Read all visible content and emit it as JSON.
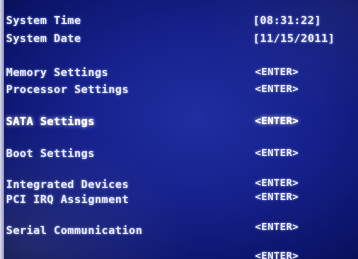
{
  "system": {
    "time_label": "System Time",
    "time_value": "[08:31:22]",
    "date_label": "System Date",
    "date_value": "[11/15/2011]"
  },
  "menu": [
    {
      "label": "Memory Settings",
      "action": "<ENTER>"
    },
    {
      "label": "Processor Settings",
      "action": "<ENTER>"
    },
    {
      "label": "SATA Settings",
      "action": "<ENTER>",
      "selected": true
    },
    {
      "label": "Boot Settings",
      "action": "<ENTER>"
    },
    {
      "label": "Integrated Devices",
      "action": "<ENTER>"
    },
    {
      "label": "PCI IRQ Assignment",
      "action": "<ENTER>"
    },
    {
      "label": "Serial Communication",
      "action": "<ENTER>"
    },
    {
      "action": "<ENTER>"
    }
  ],
  "colors": {
    "background": "#15208a",
    "text": "#e8ecff",
    "selected_text": "#ffffff"
  }
}
